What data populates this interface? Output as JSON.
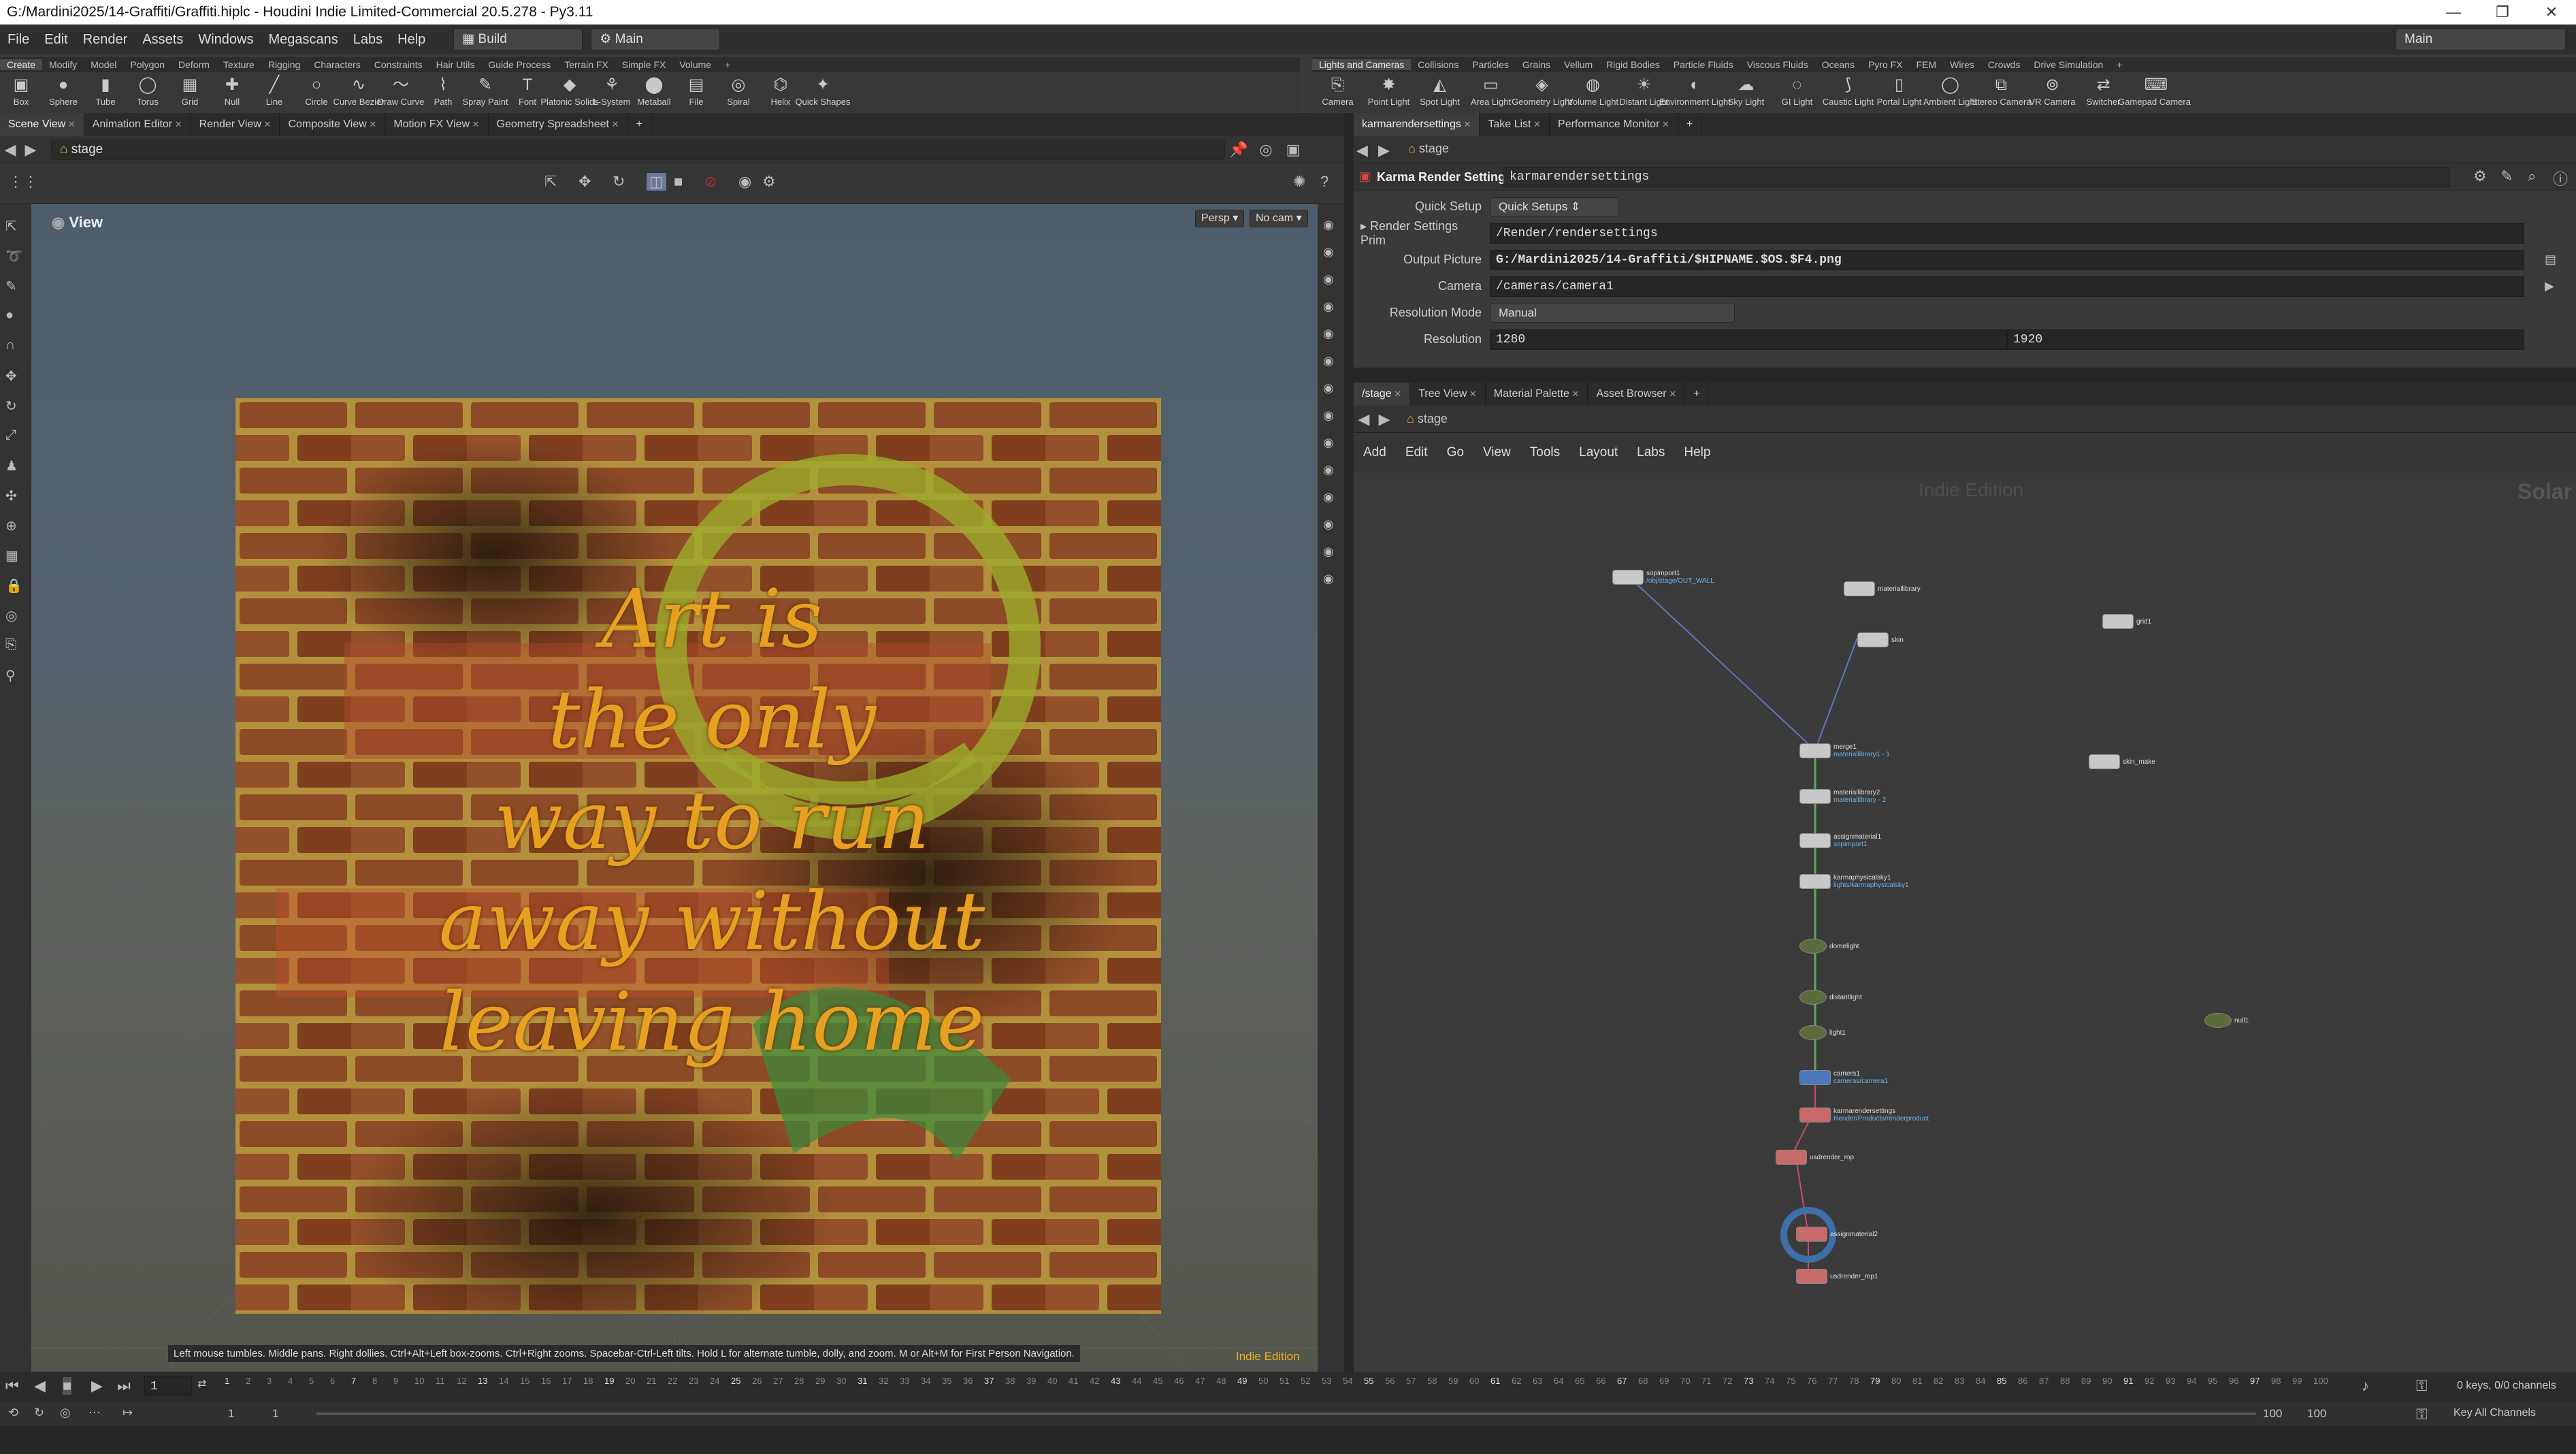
{
  "window": {
    "title": "G:/Mardini2025/14-Graffiti/Graffiti.hiplc - Houdini Indie Limited-Commercial 20.5.278 - Py3.11",
    "controls": [
      "—",
      "❐",
      "✕"
    ]
  },
  "menu": {
    "items": [
      "File",
      "Edit",
      "Render",
      "Assets",
      "Windows",
      "Megascans",
      "Labs",
      "Help"
    ],
    "desktop": "Build",
    "desktop_icon": "desktop-icon",
    "network": "Main",
    "right_network": "Main"
  },
  "shelf_left": {
    "tabs": [
      "Create",
      "Modify",
      "Model",
      "Polygon",
      "Deform",
      "Texture",
      "Rigging",
      "Characters",
      "Constraints",
      "Hair Utils",
      "Guide Process",
      "Terrain FX",
      "Simple FX",
      "Volume",
      "+"
    ],
    "tools": [
      {
        "label": "Box",
        "icon": "box-icon"
      },
      {
        "label": "Sphere",
        "icon": "sphere-icon"
      },
      {
        "label": "Tube",
        "icon": "tube-icon"
      },
      {
        "label": "Torus",
        "icon": "torus-icon"
      },
      {
        "label": "Grid",
        "icon": "grid-icon"
      },
      {
        "label": "Null",
        "icon": "null-icon"
      },
      {
        "label": "Line",
        "icon": "line-icon"
      },
      {
        "label": "Circle",
        "icon": "circle-icon"
      },
      {
        "label": "Curve Bezier",
        "icon": "curve-bezier-icon"
      },
      {
        "label": "Draw Curve",
        "icon": "draw-curve-icon"
      },
      {
        "label": "Path",
        "icon": "path-icon"
      },
      {
        "label": "Spray Paint",
        "icon": "spray-paint-icon"
      },
      {
        "label": "Font",
        "icon": "font-icon"
      },
      {
        "label": "Platonic Solids",
        "icon": "platonic-icon"
      },
      {
        "label": "L-System",
        "icon": "lsystem-icon"
      },
      {
        "label": "Metaball",
        "icon": "metaball-icon"
      },
      {
        "label": "File",
        "icon": "file-icon"
      },
      {
        "label": "Spiral",
        "icon": "spiral-icon"
      },
      {
        "label": "Helix",
        "icon": "helix-icon"
      },
      {
        "label": "Quick Shapes",
        "icon": "quick-shapes-icon"
      }
    ]
  },
  "shelf_right": {
    "tabs": [
      "Lights and Cameras",
      "Collisions",
      "Particles",
      "Grains",
      "Vellum",
      "Rigid Bodies",
      "Particle Fluids",
      "Viscous Fluids",
      "Oceans",
      "Pyro FX",
      "FEM",
      "Wires",
      "Crowds",
      "Drive Simulation",
      "+"
    ],
    "tools": [
      {
        "label": "Camera",
        "icon": "camera-icon"
      },
      {
        "label": "Point Light",
        "icon": "point-light-icon"
      },
      {
        "label": "Spot Light",
        "icon": "spot-light-icon"
      },
      {
        "label": "Area Light",
        "icon": "area-light-icon"
      },
      {
        "label": "Geometry Light",
        "icon": "geometry-light-icon"
      },
      {
        "label": "Volume Light",
        "icon": "volume-light-icon"
      },
      {
        "label": "Distant Light",
        "icon": "distant-light-icon"
      },
      {
        "label": "Environment Light",
        "icon": "environment-light-icon"
      },
      {
        "label": "Sky Light",
        "icon": "sky-light-icon"
      },
      {
        "label": "GI Light",
        "icon": "gi-light-icon"
      },
      {
        "label": "Caustic Light",
        "icon": "caustic-light-icon"
      },
      {
        "label": "Portal Light",
        "icon": "portal-light-icon"
      },
      {
        "label": "Ambient Light",
        "icon": "ambient-light-icon"
      },
      {
        "label": "Stereo Camera",
        "icon": "stereo-camera-icon"
      },
      {
        "label": "VR Camera",
        "icon": "vr-camera-icon"
      },
      {
        "label": "Switcher",
        "icon": "switcher-icon"
      },
      {
        "label": "Gamepad Camera",
        "icon": "gamepad-camera-icon"
      }
    ]
  },
  "left_pane": {
    "tabs": [
      "Scene View",
      "Animation Editor",
      "Render View",
      "Composite View",
      "Motion FX View",
      "Geometry Spreadsheet",
      "+"
    ],
    "path": "stage",
    "viewport_label": "View",
    "persp": "Persp",
    "cam": "No cam",
    "graffiti_lines": [
      "Art is",
      "the only",
      "way to run",
      "away without",
      "leaving home"
    ],
    "edition": "Indie Edition",
    "status_hint": "Left mouse tumbles. Middle pans. Right dollies. Ctrl+Alt+Left box-zooms. Ctrl+Right zooms. Spacebar-Ctrl-Left tilts. Hold L for alternate tumble, dolly, and zoom.  M or Alt+M for First Person Navigation."
  },
  "params_pane": {
    "tabs": [
      "karmarendersettings",
      "Take List",
      "Performance Monitor",
      "+"
    ],
    "node_type": "Karma Render Settings",
    "node_name": "karmarendersettings",
    "rows": [
      {
        "label": "Quick Setup",
        "value": "Quick Setups"
      },
      {
        "label": "Render Settings Prim",
        "value": "/Render/rendersettings"
      },
      {
        "label": "Output Picture",
        "value": "G:/Mardini2025/14-Graffiti/$HIPNAME.$OS.$F4.png"
      },
      {
        "label": "Camera",
        "value": "/cameras/camera1"
      },
      {
        "label": "Resolution Mode",
        "value": "Manual"
      },
      {
        "label": "Resolution",
        "value": "1280",
        "value2": "1920"
      }
    ]
  },
  "network_pane": {
    "tabs": [
      "/stage",
      "Tree View",
      "Material Palette",
      "Asset Browser",
      "+"
    ],
    "path": "stage",
    "menu": [
      "Add",
      "Edit",
      "Go",
      "View",
      "Tools",
      "Layout",
      "Labs",
      "Help"
    ],
    "watermark": "Indie Edition",
    "context": "Solar",
    "nodes": [
      {
        "name": "sopimport1",
        "sub": "/obj/stage/OUT_WALL"
      },
      {
        "name": "materiallibrary",
        "sub": ""
      },
      {
        "name": "skin",
        "sub": ""
      },
      {
        "name": "grid1",
        "sub": ""
      },
      {
        "name": "skin_make",
        "sub": ""
      },
      {
        "name": "merge1",
        "sub": "materiallibrary1 - 1"
      },
      {
        "name": "materiallibrary2",
        "sub": "materiallibrary - 2"
      },
      {
        "name": "assignmaterial1",
        "sub": "sopimport1"
      },
      {
        "name": "karmaphysicalsky1",
        "sub": "lights/karmaphysicalsky1"
      },
      {
        "name": "domelight",
        "sub": ""
      },
      {
        "name": "distantlight",
        "sub": ""
      },
      {
        "name": "light1",
        "sub": ""
      },
      {
        "name": "null1",
        "sub": ""
      },
      {
        "name": "camera1",
        "sub": "cameras/camera1"
      },
      {
        "name": "karmarendersettings",
        "sub": "Render/Products/renderproduct"
      },
      {
        "name": "usdrender_rop",
        "sub": ""
      },
      {
        "name": "assignmaterial2",
        "sub": ""
      },
      {
        "name": "usdrender_rop1",
        "sub": ""
      }
    ]
  },
  "timeline": {
    "frame": "1",
    "start": "1",
    "end_field": "1",
    "range_end": "100",
    "range_end2": "100",
    "ticks": [
      "1",
      "2",
      "3",
      "4",
      "5",
      "6",
      "7",
      "8",
      "9",
      "10",
      "11",
      "12",
      "13",
      "14",
      "15",
      "16",
      "17",
      "18",
      "19",
      "20",
      "21",
      "22",
      "23",
      "24",
      "25",
      "26",
      "27",
      "28",
      "29",
      "30",
      "31",
      "32",
      "33",
      "34",
      "35",
      "36",
      "37",
      "38",
      "39",
      "40",
      "41",
      "42",
      "43",
      "44",
      "45",
      "46",
      "47",
      "48",
      "49",
      "50",
      "51",
      "52",
      "53",
      "54",
      "55",
      "56",
      "57",
      "58",
      "59",
      "60",
      "61",
      "62",
      "63",
      "64",
      "65",
      "66",
      "67",
      "68",
      "69",
      "70",
      "71",
      "72",
      "73",
      "74",
      "75",
      "76",
      "77",
      "78",
      "79",
      "80",
      "81",
      "82",
      "83",
      "84",
      "85",
      "86",
      "87",
      "88",
      "89",
      "90",
      "91",
      "92",
      "93",
      "94",
      "95",
      "96",
      "97",
      "98",
      "99",
      "100"
    ],
    "keys": "0 keys, 0/0 channels",
    "key_all": "Key All Channels"
  },
  "colors": {
    "accent_blue": "#3f6fa8",
    "node_flag": "#4aa84a",
    "render_node": "#c85050",
    "graffiti_yellow": "#e8a020"
  }
}
